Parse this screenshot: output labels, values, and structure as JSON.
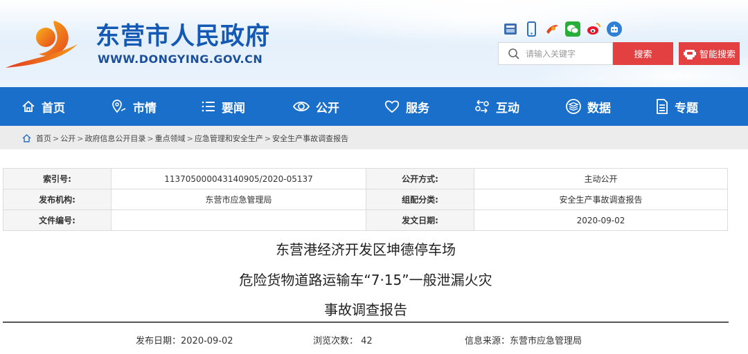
{
  "site": {
    "title": "东营市人民政府",
    "url": "WWW.DONGYING.GOV.CN"
  },
  "top_icons": [
    "app-store-icon",
    "mobile-icon",
    "toutiao-icon",
    "wechat-icon",
    "weibo-icon",
    "robot-icon"
  ],
  "search": {
    "placeholder": "请输入关键字",
    "button_label": "搜索",
    "smart_label": "智能搜索"
  },
  "nav": {
    "items": [
      {
        "label": "首页",
        "icon": "home-icon"
      },
      {
        "label": "市情",
        "icon": "city-icon"
      },
      {
        "label": "要闻",
        "icon": "list-icon"
      },
      {
        "label": "公开",
        "icon": "eye-icon"
      },
      {
        "label": "服务",
        "icon": "heart-icon"
      },
      {
        "label": "互动",
        "icon": "interact-icon"
      },
      {
        "label": "数据",
        "icon": "database-icon"
      },
      {
        "label": "专题",
        "icon": "document-icon"
      }
    ]
  },
  "breadcrumb": {
    "items": [
      "首页",
      "公开",
      "政府信息公开目录",
      "重点领域",
      "应急管理和安全生产",
      "安全生产事故调查报告"
    ],
    "separator": ">"
  },
  "info_table": {
    "index_label": "索引号:",
    "index_value": "113705000043140905/2020-05137",
    "open_mode_label": "公开方式:",
    "open_mode_value": "主动公开",
    "publisher_label": "发布机构:",
    "publisher_value": "东营市应急管理局",
    "category_label": "组配分类:",
    "category_value": "安全生产事故调查报告",
    "doc_no_label": "文件编号:",
    "doc_no_value": "",
    "issue_date_label": "发文日期:",
    "issue_date_value": "2020-09-02"
  },
  "article": {
    "title_line1": "东营港经济开发区坤德停车场",
    "title_line2": "危险货物道路运输车“7·15”一般泄漏火灾",
    "title_line3": "事故调查报告",
    "publish_date": "发布日期：2020-09-02",
    "views": "浏览次数：  42",
    "source": "信息来源：东营市应急管理局"
  },
  "colors": {
    "brand_blue": "#1a6fcb",
    "title_blue": "#1459b4",
    "search_red": "#e34042"
  }
}
